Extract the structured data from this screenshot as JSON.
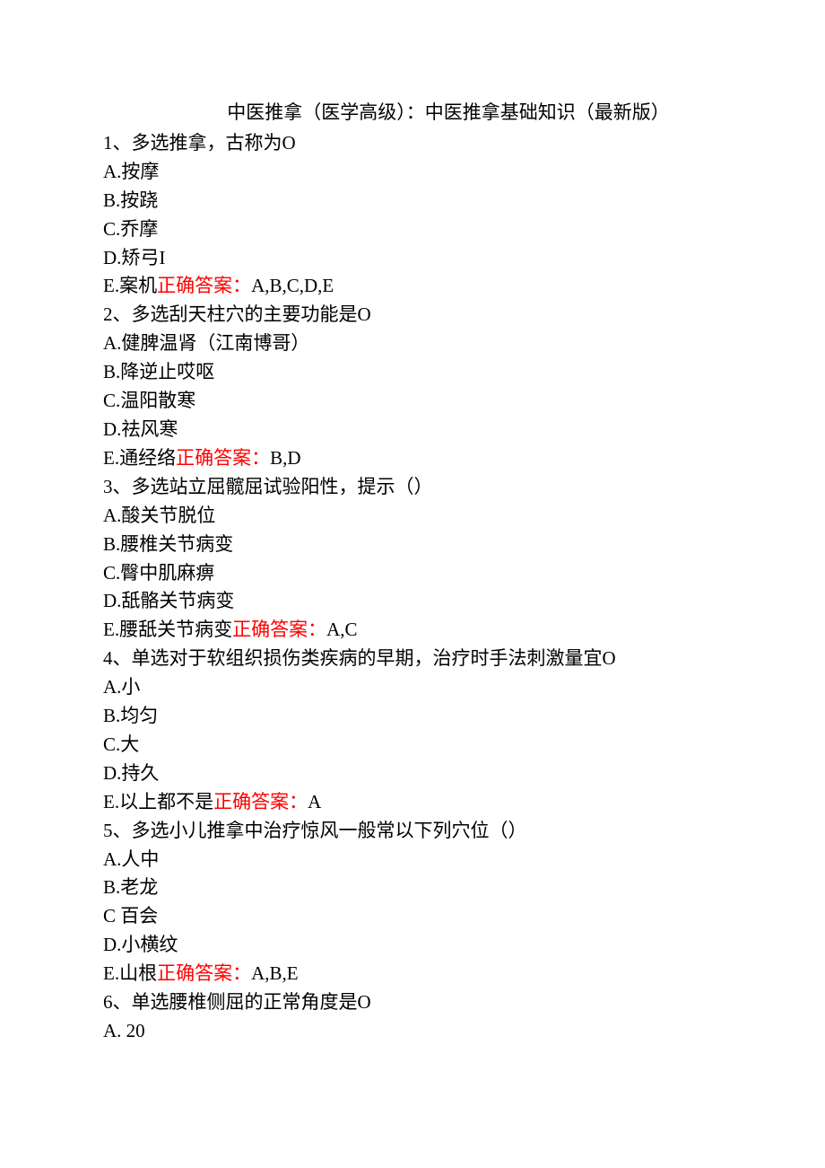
{
  "title": "中医推拿（医学高级）：中医推拿基础知识（最新版）",
  "questions": [
    {
      "stem": "1、多选推拿，古称为O",
      "options": [
        "A.按摩",
        "B.按跷",
        "C.乔摩",
        "D.矫弓I"
      ],
      "last_option_prefix": "E.案机",
      "answer_label": "正确答案：",
      "answer_value": "A,B,C,D,E"
    },
    {
      "stem": "2、多选刮天柱穴的主要功能是O",
      "options": [
        "A.健脾温肾（江南博哥）",
        "B.降逆止哎呕",
        "C.温阳散寒",
        "D.祛风寒"
      ],
      "last_option_prefix": "E.通经络",
      "answer_label": "正确答案：",
      "answer_value": "B,D"
    },
    {
      "stem": "3、多选站立屈髋屈试验阳性，提示（）",
      "options": [
        "A.酸关节脱位",
        "B.腰椎关节病变",
        "C.臀中肌麻痹",
        "D.舐骼关节病变"
      ],
      "last_option_prefix": "E.腰舐关节病变",
      "answer_label": "正确答案：",
      "answer_value": "A,C"
    },
    {
      "stem": "4、单选对于软组织损伤类疾病的早期，治疗时手法刺激量宜O",
      "options": [
        "A.小",
        "B.均匀",
        "C.大",
        "D.持久"
      ],
      "last_option_prefix": "E.以上都不是",
      "answer_label": "正确答案：",
      "answer_value": "A"
    },
    {
      "stem": "5、多选小儿推拿中治疗惊风一般常以下列穴位（）",
      "options": [
        "A.人中",
        "B.老龙",
        "C 百会",
        "D.小横纹"
      ],
      "last_option_prefix": "E.山根",
      "answer_label": "正确答案：",
      "answer_value": "A,B,E"
    },
    {
      "stem": "6、单选腰椎侧屈的正常角度是O",
      "options": [
        "A. 20"
      ],
      "last_option_prefix": "",
      "answer_label": "",
      "answer_value": ""
    }
  ]
}
